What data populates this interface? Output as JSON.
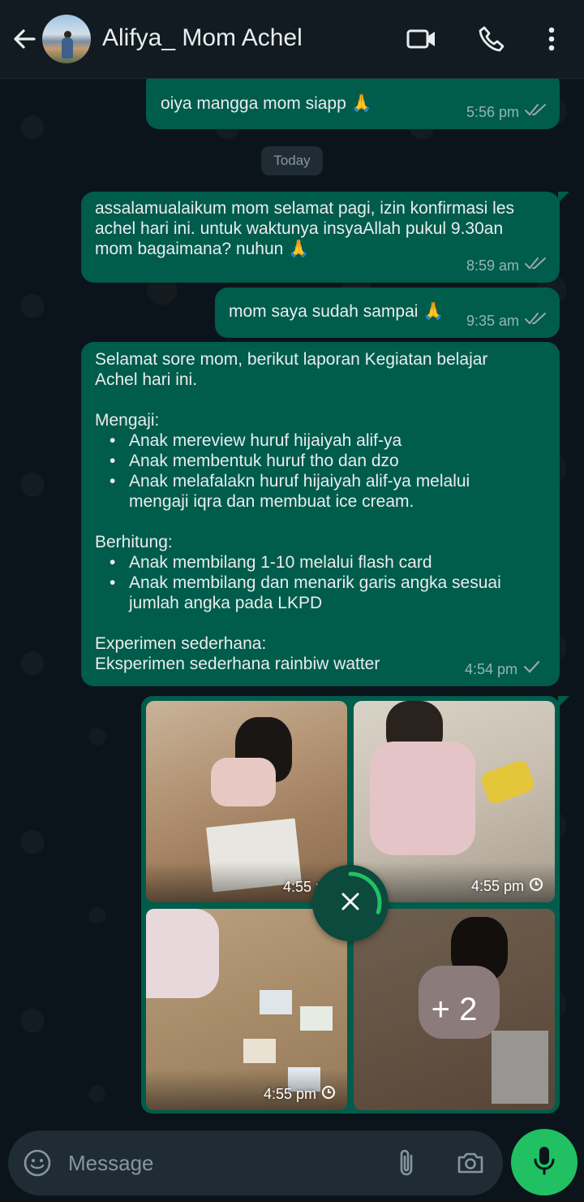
{
  "header": {
    "contact_name": "Alifya_ Mom Achel",
    "icons": [
      "back-arrow-icon",
      "video-call-icon",
      "voice-call-icon",
      "more-options-icon"
    ]
  },
  "chat": {
    "messages": [
      {
        "text": "oiya mangga mom siapp 🙏",
        "time": "5:56 pm",
        "status": "read"
      },
      {
        "text": "assalamualaikum mom selamat pagi, izin konfirmasi les achel hari ini. untuk waktunya insyaAllah pukul 9.30an mom bagaimana? nuhun 🙏",
        "time": "8:59 am",
        "status": "read"
      },
      {
        "text": "mom saya sudah sampai 🙏",
        "time": "9:35 am",
        "status": "read"
      }
    ],
    "date_separator": "Today",
    "report": {
      "intro": "Selamat sore mom,  berikut laporan Kegiatan belajar Achel hari ini.",
      "section1_title": "Mengaji:",
      "section1_items": [
        "Anak mereview huruf hijaiyah alif-ya",
        "Anak membentuk huruf tho dan dzo",
        "Anak melafalakn huruf hijaiyah alif-ya melalui mengaji iqra dan membuat ice cream."
      ],
      "section2_title": "Berhitung:",
      "section2_items": [
        "Anak membilang 1-10 melalui flash card",
        "Anak membilang dan menarik garis angka sesuai jumlah angka pada LKPD"
      ],
      "section3_title": "Experimen sederhana:",
      "section3_text": "Eksperimen sederhana rainbiw watter",
      "time": "4:54 pm",
      "status": "sent"
    },
    "media": {
      "photos": [
        {
          "time": "4:55 pm",
          "pending": false
        },
        {
          "time": "4:55 pm",
          "pending": true
        },
        {
          "time": "4:55 pm",
          "pending": true
        },
        {
          "time": "",
          "pending": false
        }
      ],
      "more_count": "+ 2",
      "upload_progress": 0.3
    }
  },
  "composer": {
    "placeholder": "Message",
    "icons": [
      "emoji-icon",
      "attach-icon",
      "camera-icon",
      "mic-icon"
    ]
  },
  "colors": {
    "header_bg": "#111b21",
    "bubble_out": "#005c4b",
    "chat_bg": "#0b141a",
    "accent_green": "#21c063"
  }
}
